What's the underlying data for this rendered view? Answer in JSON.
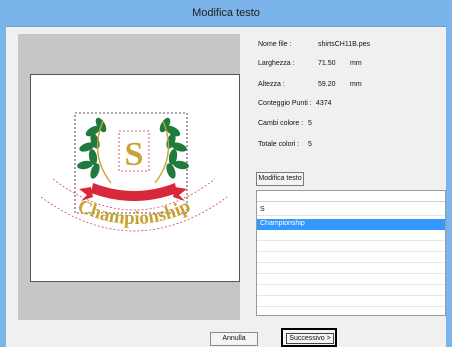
{
  "window": {
    "title": "Modifica testo"
  },
  "info": {
    "file_name_label": "Nome file :",
    "file_name_value": "shirtsCH11B.pes",
    "width_label": "Larghezza :",
    "width_value": "71.50",
    "width_unit": "mm",
    "height_label": "Altezza :",
    "height_value": "59.20",
    "height_unit": "mm",
    "stitch_count_label": "Conteggio Punti :",
    "stitch_count_value": "4374",
    "color_changes_label": "Cambi colore :",
    "color_changes_value": "5",
    "total_colors_label": "Totale colori :",
    "total_colors_value": "5"
  },
  "edit_button": {
    "label": "Modifica testo"
  },
  "text_list": {
    "items": [
      {
        "text": "S",
        "selected": false
      },
      {
        "text": "Championship",
        "selected": true
      }
    ]
  },
  "preview": {
    "monogram": "S",
    "arc_text": "Championship"
  },
  "buttons": {
    "cancel": "Annulla",
    "next": "Successivo >"
  },
  "colors": {
    "laurel": "#1f7a3c",
    "ribbon": "#d8283a",
    "gold": "#c9a233",
    "selection": "#3399ff"
  }
}
